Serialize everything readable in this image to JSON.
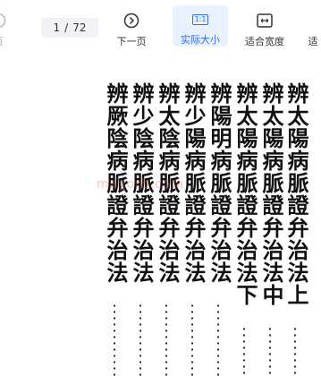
{
  "toolbar": {
    "prev_label": "页",
    "page_current": "1",
    "page_sep": "/",
    "page_total": "72",
    "next_label": "下一页",
    "actual_size_icon_text": "1:1",
    "actual_size_label": "实际大小",
    "fit_width_label": "适合宽度",
    "cut_label": "适"
  },
  "page": {
    "columns": [
      "辨太陽病脈證弁治法上",
      "辨太陽病脈證弁治法中",
      "辨太陽病脈證弁治法下",
      "辨陽明病脈證弁治法",
      "辨少陽病脈證弁治法",
      "辨太陰病脈證弁治法",
      "辨少陰病脈證弁治法",
      "辨厥陰病脈證弁治法"
    ],
    "watermark": "mayorb.com"
  }
}
